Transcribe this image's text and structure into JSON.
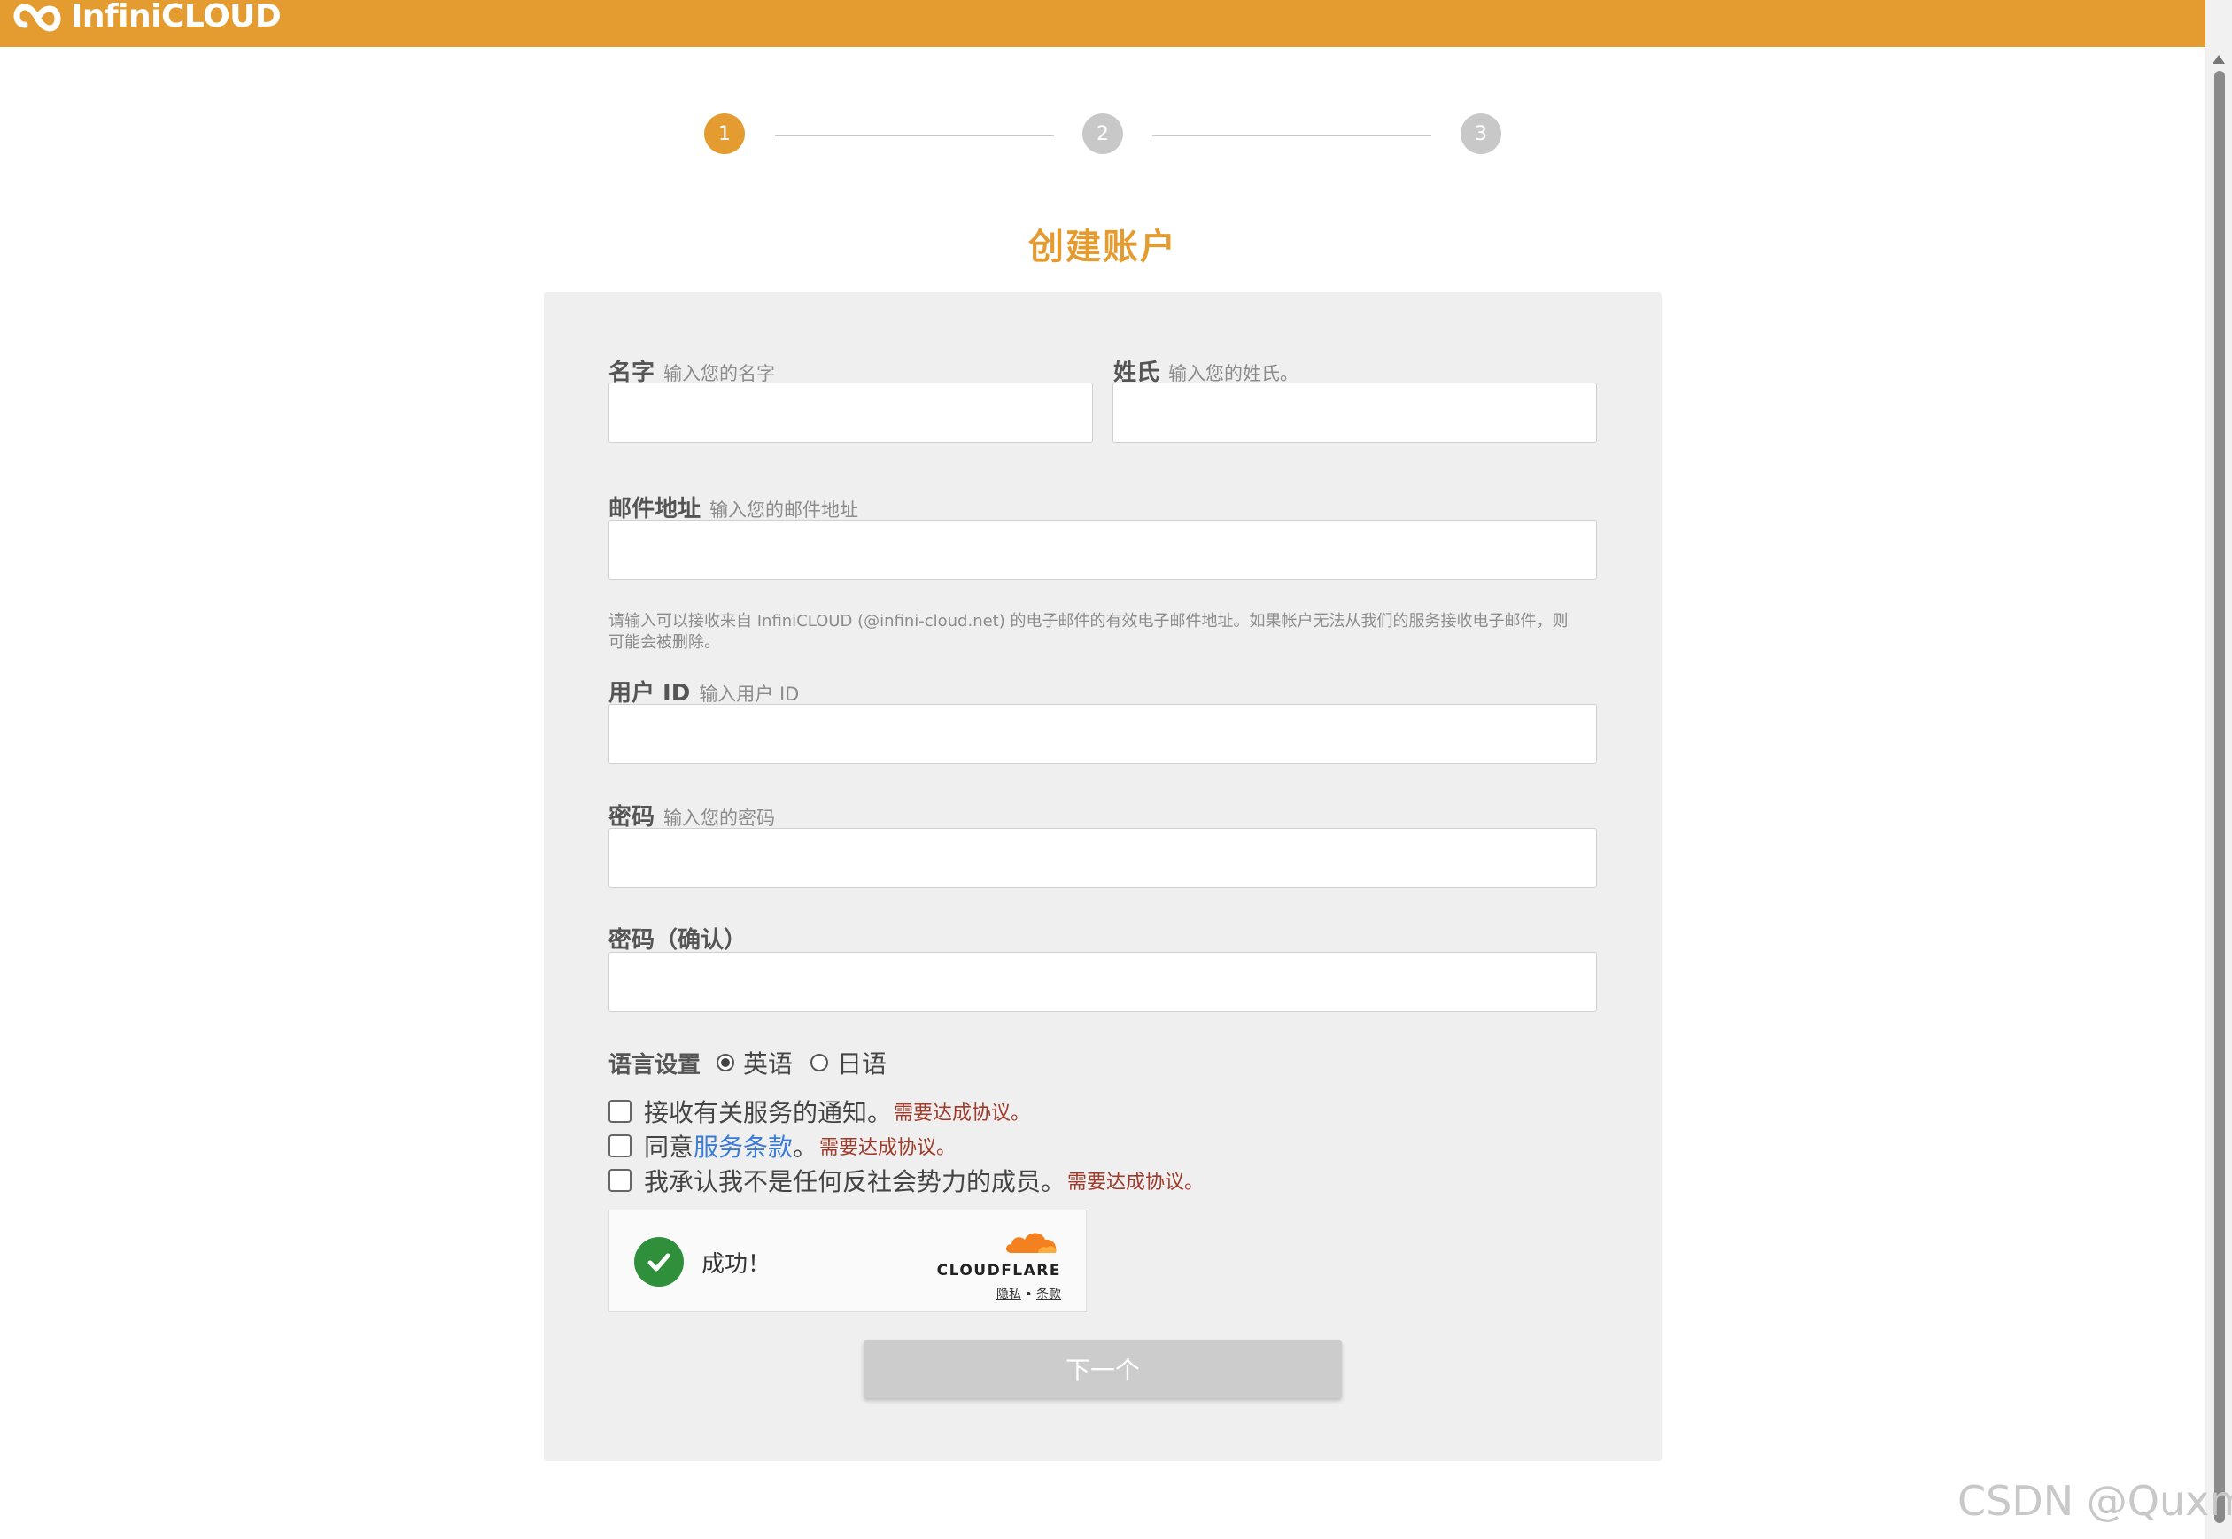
{
  "header": {
    "brand": "InfiniCLOUD",
    "color": "#e49c30"
  },
  "stepper": {
    "steps": [
      "1",
      "2",
      "3"
    ],
    "active_step": 1
  },
  "title": "创建账户",
  "form": {
    "first_name": {
      "label": "名字",
      "hint": "输入您的名字",
      "value": ""
    },
    "last_name": {
      "label": "姓氏",
      "hint": "输入您的姓氏。",
      "value": ""
    },
    "email": {
      "label": "邮件地址",
      "hint": "输入您的邮件地址",
      "value": ""
    },
    "email_note": "请输入可以接收来自 InfiniCLOUD (@infini-cloud.net) 的电子邮件的有效电子邮件地址。如果帐户无法从我们的服务接收电子邮件，则可能会被删除。",
    "user_id": {
      "label": "用户 ID",
      "hint": "输入用户 ID",
      "value": ""
    },
    "password": {
      "label": "密码",
      "hint": "输入您的密码",
      "value": ""
    },
    "password_confirm": {
      "label": "密码（确认）",
      "value": ""
    },
    "language": {
      "label": "语言设置",
      "options": [
        "英语",
        "日语"
      ],
      "selected": "英语"
    },
    "checks": {
      "notify": {
        "text": "接收有关服务的通知。",
        "required": "需要达成协议。",
        "checked": false
      },
      "terms": {
        "prefix": "同意",
        "link": "服务条款",
        "suffix": "。",
        "required": "需要达成协议。",
        "checked": false
      },
      "antisocial": {
        "text": "我承认我不是任何反社会势力的成员。",
        "required": "需要达成协议。",
        "checked": false
      }
    },
    "captcha": {
      "status": "成功！",
      "brand": "CLOUDFLARE",
      "privacy": "隐私",
      "sep": "•",
      "terms": "条款"
    },
    "next_button": "下一个"
  },
  "watermark": "CSDN @Quxm"
}
